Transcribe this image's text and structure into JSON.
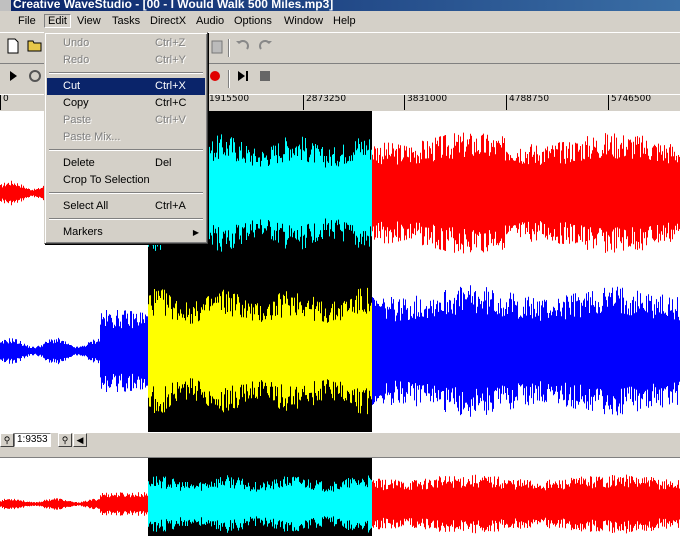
{
  "window": {
    "title": "Creative WaveStudio - [00 - I Would Walk 500 Miles.mp3]"
  },
  "menubar": {
    "items": [
      "File",
      "Edit",
      "View",
      "Tasks",
      "DirectX",
      "Audio",
      "Options",
      "Window",
      "Help"
    ]
  },
  "edit_menu": {
    "undo": {
      "label": "Undo",
      "shortcut": "Ctrl+Z"
    },
    "redo": {
      "label": "Redo",
      "shortcut": "Ctrl+Y"
    },
    "cut": {
      "label": "Cut",
      "shortcut": "Ctrl+X"
    },
    "copy": {
      "label": "Copy",
      "shortcut": "Ctrl+C"
    },
    "paste": {
      "label": "Paste",
      "shortcut": "Ctrl+V"
    },
    "paste_mix": {
      "label": "Paste Mix..."
    },
    "delete": {
      "label": "Delete",
      "shortcut": "Del"
    },
    "crop": {
      "label": "Crop To Selection"
    },
    "select_all": {
      "label": "Select All",
      "shortcut": "Ctrl+A"
    },
    "markers": {
      "label": "Markers"
    }
  },
  "ruler": {
    "labels": [
      "0",
      "1915500",
      "2873250",
      "3831000",
      "4788750",
      "5746500"
    ]
  },
  "zoom": {
    "value": "1:9353"
  },
  "colors": {
    "channel_top": "#ff0000",
    "channel_top_selected": "#00ffff",
    "channel_bottom": "#0000ff",
    "channel_bottom_selected": "#ffff00",
    "selection_background": "#000000",
    "menu_highlight": "#0a246a"
  },
  "icons": [
    "app-icon",
    "new-icon",
    "open-icon",
    "undo-icon",
    "redo-icon",
    "play-icon",
    "loop-icon",
    "record-icon",
    "play-to-end-icon",
    "stop-icon",
    "zoom-in-icon",
    "zoom-out-icon",
    "scroll-left-icon",
    "submenu-arrow-icon"
  ]
}
